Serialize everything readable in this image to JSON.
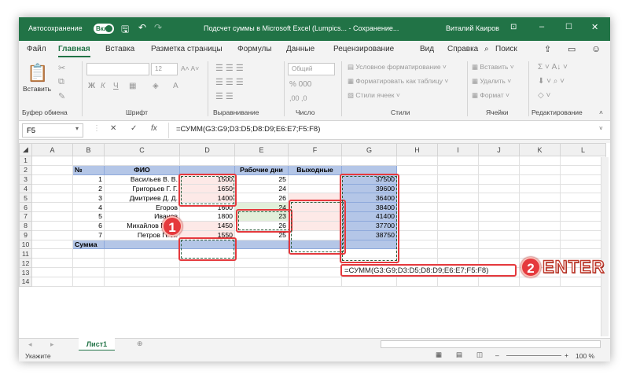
{
  "titlebar": {
    "autosave": "Автосохранение",
    "autosave_state": "Вкл",
    "doc_title": "Подсчет суммы в Microsoft Excel (Lumpics...  -  Сохранение...",
    "user": "Виталий Каиров"
  },
  "ribbon_tabs": [
    "Файл",
    "Главная",
    "Вставка",
    "Разметка страницы",
    "Формулы",
    "Данные",
    "Рецензирование",
    "Вид",
    "Справка",
    "Поиск"
  ],
  "ribbon": {
    "paste": "Вставить",
    "font_size": "12",
    "number_format": "Общий",
    "cond_format": "Условное форматирование",
    "format_table": "Форматировать как таблицу",
    "cell_styles": "Стили ячеек",
    "insert": "Вставить",
    "delete": "Удалить",
    "format": "Формат",
    "groups": [
      "Буфер обмена",
      "Шрифт",
      "Выравнивание",
      "Число",
      "Стили",
      "Ячейки",
      "Редактирование"
    ]
  },
  "formula_bar": {
    "name_box": "F5",
    "fx": "fx",
    "formula": "=СУММ(G3:G9;D3:D5;D8:D9;E6:E7;F5:F8)"
  },
  "columns": [
    "A",
    "B",
    "C",
    "D",
    "E",
    "F",
    "G",
    "H",
    "I",
    "J",
    "K",
    "L"
  ],
  "rows": [
    "1",
    "2",
    "3",
    "4",
    "5",
    "6",
    "7",
    "8",
    "9",
    "10",
    "11",
    "12",
    "13",
    "14"
  ],
  "table": {
    "headers": {
      "no": "№",
      "name": "ФИО",
      "workdays": "Рабочие дни",
      "weekends": "Выходные"
    },
    "rows": [
      {
        "no": "1",
        "name": "Васильев В. В.",
        "d": "1500",
        "e": "25",
        "g": "37500"
      },
      {
        "no": "2",
        "name": "Григорьев Г. Г.",
        "d": "1650",
        "e": "24",
        "g": "39600"
      },
      {
        "no": "3",
        "name": "Дмитриев Д. Д.",
        "d": "1400",
        "e": "26",
        "g": "36400"
      },
      {
        "no": "4",
        "name": "Егоров",
        "d": "1600",
        "e": "24",
        "g": "38400"
      },
      {
        "no": "5",
        "name": "Иванов",
        "d": "1800",
        "e": "23",
        "g": "41400"
      },
      {
        "no": "6",
        "name": "Михайлов М. М.",
        "d": "1450",
        "e": "26",
        "g": "37700"
      },
      {
        "no": "7",
        "name": "Петров П. П.",
        "d": "1550",
        "e": "25",
        "g": "38750"
      }
    ],
    "sum_label": "Сумма"
  },
  "editing_formula": "=СУММ(G3:G9;D3:D5;D8:D9;E6:E7;F5:F8)",
  "annotations": {
    "step1": "1",
    "step2": "2",
    "enter": "ENTER"
  },
  "sheet_tab": "Лист1",
  "status": {
    "mode": "Укажите",
    "zoom": "100 %"
  }
}
